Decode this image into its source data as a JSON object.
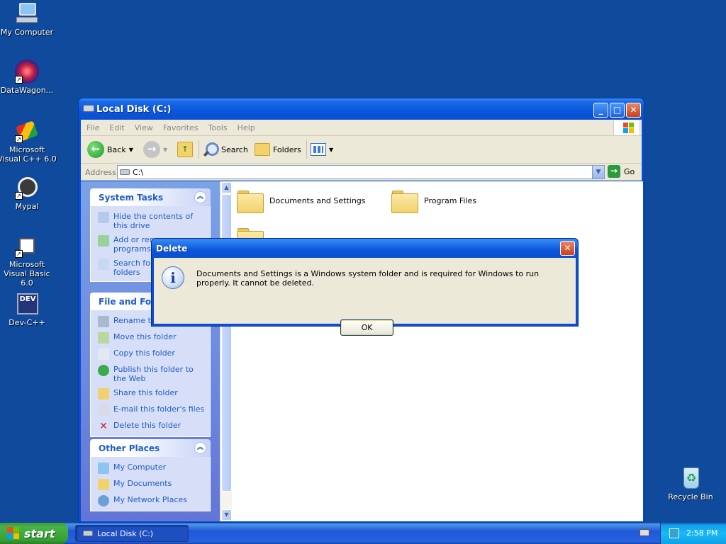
{
  "desktop": {
    "icons": [
      {
        "label": "My Computer"
      },
      {
        "label": "DataWagon..."
      },
      {
        "label": "Microsoft Visual C++ 6.0"
      },
      {
        "label": "Mypal"
      },
      {
        "label": "Microsoft Visual Basic 6.0"
      },
      {
        "label": "Dev-C++"
      },
      {
        "label": "Recycle Bin"
      }
    ],
    "dev_icon_text": "DEV"
  },
  "window": {
    "title": "Local Disk (C:)",
    "menu": [
      "File",
      "Edit",
      "View",
      "Favorites",
      "Tools",
      "Help"
    ],
    "toolbar": {
      "back": "Back",
      "search": "Search",
      "folders": "Folders"
    },
    "address": {
      "label": "Address",
      "value": "C:\\",
      "go": "Go"
    },
    "task_groups": [
      {
        "title": "System Tasks",
        "tasks": [
          "Hide the contents of this drive",
          "Add or remove programs",
          "Search for files or folders"
        ]
      },
      {
        "title": "File and Folder Tasks",
        "tasks": [
          "Rename this folder",
          "Move this folder",
          "Copy this folder",
          "Publish this folder to the Web",
          "Share this folder",
          "E-mail this folder's files",
          "Delete this folder"
        ]
      },
      {
        "title": "Other Places",
        "tasks": [
          "My Computer",
          "My Documents",
          "My Network Places"
        ]
      }
    ],
    "folders": [
      "Documents and Settings",
      "Program Files"
    ]
  },
  "dialog": {
    "title": "Delete",
    "message": "Documents and Settings is a Windows system folder and is required for Windows to run properly. It cannot be deleted.",
    "ok": "OK"
  },
  "taskbar": {
    "start": "start",
    "task_label": "Local Disk (C:)",
    "clock": "2:58 PM"
  },
  "colors": {
    "desktop": "#0f4a9c",
    "titlebar": "#0a56dc",
    "task_link": "#215dc6",
    "start_green": "#48b348"
  }
}
